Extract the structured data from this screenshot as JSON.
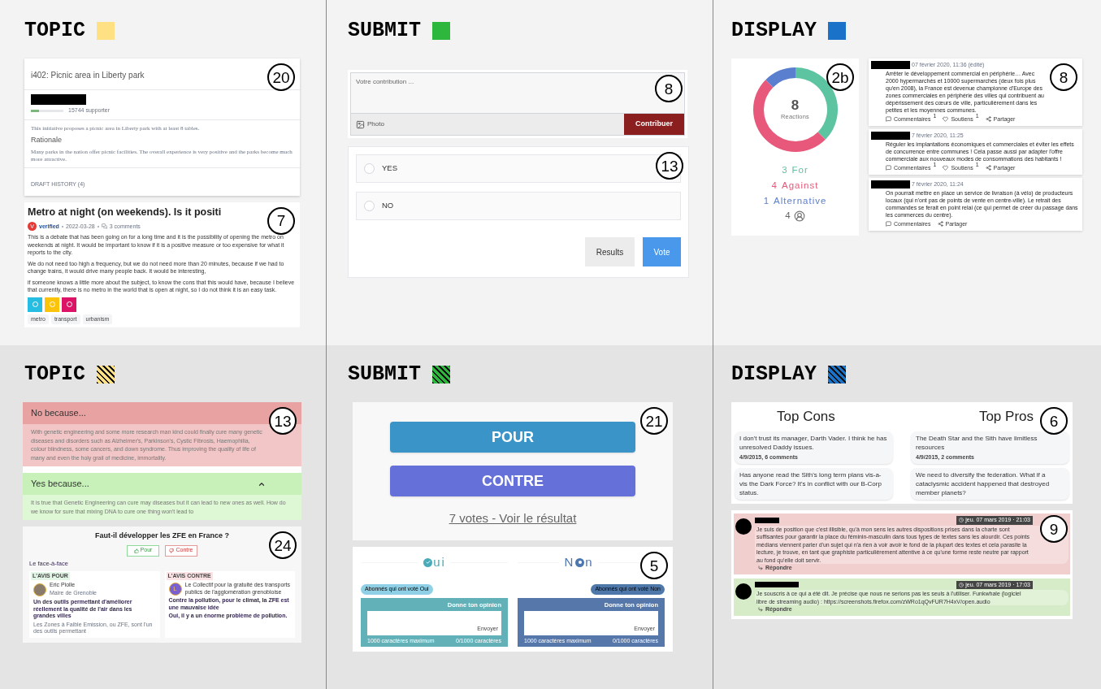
{
  "rows": [
    {
      "cells": [
        {
          "heading": "TOPIC",
          "swatch": {
            "color": "#ffe083",
            "striped": false
          },
          "panels": [
            {
              "kind": "initiative",
              "number": "20",
              "title": "i402: Picnic area in Liberty park",
              "level": 0.25,
              "supporters": "15744 supporter",
              "description": "This initiative proposes a picnic area in Liberty park with at least 8 tables.",
              "rationale_heading": "Rationale",
              "rationale": "Many parks in the nation offer picnic facilities. The overall experience is very positive and the parks become much more attractive.",
              "footer": "DRAFT HISTORY (4)"
            },
            {
              "kind": "post",
              "number": "7",
              "title": "Metro at night (on weekends). Is it positi",
              "avatar": "V",
              "author": "verified",
              "date": "2022-03-28",
              "comments": "3 comments",
              "paragraphs": [
                "This is a debate that has been going on for a long time and it is the possibility of opening the metro on weekends at night. It would be important to know if it is a positive measure or too expensive for what it reports to the city.",
                "We do not need too high a frequency, but we do not need more than 20 minutes, because if we had to change trains, it would drive many people back. It would be interesting,",
                "if someone knows a little more about the subject, to know the cons that this would have, because I believe that currently, there is no metro in the world that is open at night, so I do not think it is an easy task."
              ],
              "goals": [
                {
                  "color": "#26bde2"
                },
                {
                  "color": "#fcc30b"
                },
                {
                  "color": "#dd1367"
                }
              ],
              "tags": [
                "metro",
                "transport",
                "urbanism"
              ]
            }
          ]
        },
        {
          "heading": "SUBMIT",
          "swatch": {
            "color": "#2db83d",
            "striped": false
          },
          "panels": [
            {
              "kind": "composer",
              "number": "8",
              "placeholder": "Votre contribution ...",
              "photo": "Photo",
              "submit": "Contribuer"
            },
            {
              "kind": "poll",
              "number": "13",
              "options": [
                {
                  "label": "YES",
                  "selected": false
                },
                {
                  "label": "NO",
                  "selected": false
                }
              ],
              "buttons": [
                {
                  "kind": "secondary",
                  "label": "Results"
                },
                {
                  "kind": "primary",
                  "label": "Vote"
                }
              ]
            }
          ]
        },
        {
          "heading": "DISPLAY",
          "swatch": {
            "color": "#1a73c8",
            "striped": false
          },
          "panels": [
            {
              "kind": "donut",
              "number": "2b",
              "total": "8",
              "chart_data": {
                "type": "donut",
                "categories": [
                  "For",
                  "Against",
                  "Alternative"
                ],
                "series": [
                  {
                    "name": "Reactions",
                    "values": [
                      37.5,
                      50,
                      12.5
                    ]
                  }
                ]
              },
              "legend": [
                {
                  "count": "3",
                  "color": "#5cc4a0"
                },
                {
                  "count": "4",
                  "color": "#e8587a"
                },
                {
                  "count": "1",
                  "color": "#5b7fcf"
                }
              ],
              "participants": "4"
            },
            {
              "kind": "feed",
              "number": "8",
              "posts": [
                {
                  "date": "07 février 2020, 11:36 (édité)",
                  "text": "Arrêter le développement commercial en périphérie… Avec 2000 hypermarchés et 10000 supermarchés (deux fois plus qu'en 2008), la France est devenue championne d'Europe des zones commerciales en périphérie des villes qui contribuent au dépérissement des cœurs de ville, particulièrement dans les petites et les moyennes communes.",
                  "actions": [
                    {
                      "kind": "comment",
                      "label": "Commentaires",
                      "count": "1"
                    },
                    {
                      "kind": "support",
                      "label": "Soutiens",
                      "count": "1"
                    },
                    {
                      "kind": "share",
                      "label": "Partager"
                    }
                  ]
                },
                {
                  "date": "7 février 2020, 11:25",
                  "text": "Réguler les implantations économiques et commerciales et éviter les effets de concurrence entre communes ! Cela passe aussi par adapter l'offre commerciale aux nouveaux modes de consommations des habitants !",
                  "actions": [
                    {
                      "kind": "comment",
                      "label": "Commentaires",
                      "count": "1"
                    },
                    {
                      "kind": "support",
                      "label": "Soutiens",
                      "count": "1"
                    },
                    {
                      "kind": "share",
                      "label": "Partager"
                    }
                  ]
                },
                {
                  "date": "7 février 2020, 11:24",
                  "text": "On pourrait mettre en place un service de livraison (à vélo) de producteurs locaux (qui n'ont pas de points de vente en centre-ville). Le retrait des commandes se ferait en point relai (ce qui permet de créer du passage dans les commerces du centre).",
                  "actions": [
                    {
                      "kind": "comment",
                      "label": "Commentaires"
                    },
                    {
                      "kind": "share",
                      "label": "Partager"
                    }
                  ]
                }
              ]
            }
          ]
        }
      ]
    },
    {
      "cells": [
        {
          "heading": "TOPIC",
          "swatch": {
            "color": "#ffe083",
            "striped": true
          },
          "panels": [
            {
              "kind": "accordion",
              "number": "13",
              "sections": [
                {
                  "kind": "con",
                  "title": "No because...",
                  "expanded": true,
                  "collapsible": false,
                  "body": "With genetic engineering and some more research man kind could finally cure many genetic diseases and disorders such as Alzheimer's, Parkinson's, Cystic Fibrosis, Haemophilia, colour blindness, some cancers, and down syndrome. Thus improving the quality of life of many and even the holy grail of medicine, immortality."
                },
                {
                  "kind": "pro",
                  "title": "Yes because...",
                  "expanded": true,
                  "collapsible": true,
                  "body": "It is true that Genetic Engineering can cure may diseases but it can lead to new ones as well. How do we know for sure that mixing DNA to cure one thing won't lead to"
                }
              ]
            },
            {
              "kind": "debate",
              "number": "24",
              "title": "Faut-il développer les ZFE en France ?",
              "buttons": [
                {
                  "kind": "pro",
                  "label": "Pour"
                },
                {
                  "kind": "con",
                  "label": "Contre"
                }
              ],
              "section": "Le face-à-face",
              "cards": [
                {
                  "kind": "pro",
                  "tag": "L'AVIS POUR",
                  "avatar": {
                    "kind": "photo"
                  },
                  "name": "Eric Piolle",
                  "role": "Maire de Grenoble",
                  "headline": "Un des outils permettant d'améliorer réellement la qualité de l'air dans les grandes villes",
                  "snippet": "Les Zones à Faible Emission, ou ZFE, sont l'un des outils permettant"
                },
                {
                  "kind": "con",
                  "tag": "L'AVIS CONTRE",
                  "avatar": {
                    "kind": "letter",
                    "letter": "L"
                  },
                  "name": "Le Collectif pour la gratuité des transports publics de l'agglomération grenobloise",
                  "headline": "Contre la pollution, pour le climat, la ZFE est une mauvaise idée",
                  "snippet": "Oui, il y a un énorme problème de pollution."
                }
              ]
            }
          ]
        },
        {
          "heading": "SUBMIT",
          "swatch": {
            "color": "#2db83d",
            "striped": true
          },
          "panels": [
            {
              "kind": "vote_buttons",
              "number": "21",
              "buttons": [
                {
                  "kind": "pro",
                  "label": "POUR"
                },
                {
                  "kind": "con",
                  "label": "CONTRE"
                }
              ],
              "link": "7 votes - Voir le résultat"
            },
            {
              "kind": "opinion",
              "number": "5",
              "sides": [
                {
                  "kind": "pro",
                  "suffix": "ui",
                  "pill": "Abonnés qui ont voté Oui",
                  "title": "Donne ton opinion",
                  "send": "Envoyer",
                  "limit": "1000 caractères maximum",
                  "counter": "0/1000 caractères"
                },
                {
                  "kind": "con",
                  "prefix": "N",
                  "suffix": "n",
                  "pill": "Abonnés qui ont voté Non",
                  "title": "Donne ton opinion",
                  "send": "Envoyer",
                  "limit": "1000 caractères maximum",
                  "counter": "0/1000 caractères"
                }
              ]
            }
          ]
        },
        {
          "heading": "DISPLAY",
          "swatch": {
            "color": "#1a73c8",
            "striped": true
          },
          "panels": [
            {
              "kind": "top_list",
              "number": "6",
              "columns": [
                {
                  "title": "Top Cons",
                  "items": [
                    {
                      "text": "I don't trust its manager, Darth Vader. I think he has unresolved Daddy issues.",
                      "meta": "4/9/2015, 6 comments"
                    },
                    {
                      "text": "Has anyone read the Sith's long term plans vis-a-vis the Dark Force? It's in conflict with our B-Corp status."
                    }
                  ]
                },
                {
                  "title": "Top Pros",
                  "items": [
                    {
                      "text": "The Death Star and the Sith have limitless resources",
                      "meta": "4/9/2015, 2 comments"
                    },
                    {
                      "text": "We need to diversify the federation. What if a cataclysmic accident happened that destroyed member planets?"
                    }
                  ]
                }
              ]
            },
            {
              "kind": "comments",
              "number": "9",
              "comments": [
                {
                  "kind": "con",
                  "date": "jeu. 07 mars 2019 · 21:03",
                  "text": "Je suis de position que c'est illisible, qu'à mon sens les autres dispositions prises dans la charte sont suffisantes pour garantir la place du féminin-masculin dans tous types de textes sans les alourdir. Ces points médians viennent parler d'un sujet qui n'a rien à voir avoir le fond de la plupart des textes et cela parasite la lecture, je trouve, en tant que graphiste particulièrement attentive à ce qu'une forme reste neutre par rapport au fond qu'elle doit servir.",
                  "reply": "Répondre"
                },
                {
                  "kind": "pro",
                  "date": "jeu. 07 mars 2019 · 17:03",
                  "text": "Je souscris à ce qui a été dit. Je précise que nous ne serions pas les seuls à l'utiliser. Funkwhale (logiciel libre de streaming audio) : https://screenshots.firefox.com/zWRo1qQvFUR7H4xV/open.audio",
                  "reply": "Répondre"
                }
              ]
            }
          ]
        }
      ]
    }
  ]
}
